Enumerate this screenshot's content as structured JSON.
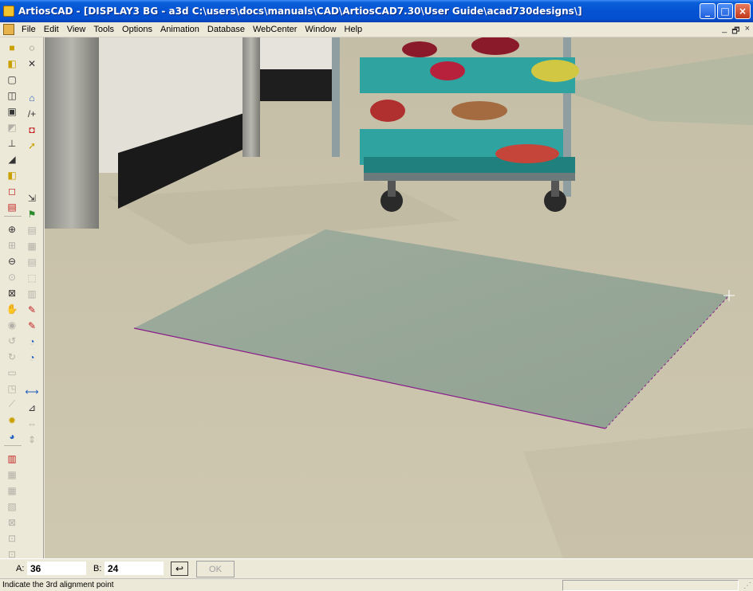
{
  "window": {
    "title": "ArtiosCAD - [DISPLAY3 BG - a3d C:\\users\\docs\\manuals\\CAD\\ArtiosCAD7.30\\User Guide\\acad730designs\\]",
    "caption_buttons": {
      "minimize": "_",
      "maximize": "□",
      "close": "×"
    }
  },
  "menubar": {
    "items": [
      {
        "label": "File"
      },
      {
        "label": "Edit"
      },
      {
        "label": "View"
      },
      {
        "label": "Tools"
      },
      {
        "label": "Options"
      },
      {
        "label": "Animation"
      },
      {
        "label": "Database"
      },
      {
        "label": "WebCenter"
      },
      {
        "label": "Window"
      },
      {
        "label": "Help"
      }
    ],
    "mdi_minimize": "_",
    "mdi_restore": "🗗",
    "mdi_close": "×"
  },
  "toolbar": {
    "col1": [
      {
        "icon": "yellow-box-icon",
        "glyph": "■",
        "tone": "yellow"
      },
      {
        "icon": "box-solid-icon",
        "glyph": "◧",
        "tone": "yellow"
      },
      {
        "icon": "box-outline-icon",
        "glyph": "▢",
        "tone": "normal"
      },
      {
        "icon": "box-3d-icon",
        "glyph": "◫",
        "tone": "normal"
      },
      {
        "icon": "box-front-icon",
        "glyph": "▣",
        "tone": "normal"
      },
      {
        "icon": "fold-icon",
        "glyph": "◩",
        "tone": "dim"
      },
      {
        "icon": "pin-icon",
        "glyph": "⊥",
        "tone": "normal"
      },
      {
        "icon": "paint-icon",
        "glyph": "◢",
        "tone": "normal"
      },
      {
        "icon": "green-box-icon",
        "glyph": "◧",
        "tone": "yellow"
      },
      {
        "icon": "red-box-icon",
        "glyph": "◻",
        "tone": "red"
      },
      {
        "icon": "pallet-icon",
        "glyph": "▤",
        "tone": "red"
      },
      {
        "sep": true
      },
      {
        "icon": "zoom-in-icon",
        "glyph": "⊕",
        "tone": "normal"
      },
      {
        "icon": "zoom-window-icon",
        "glyph": "⊞",
        "tone": "dim"
      },
      {
        "icon": "zoom-out-icon",
        "glyph": "⊖",
        "tone": "normal"
      },
      {
        "icon": "zoom-prev-icon",
        "glyph": "⊙",
        "tone": "dim"
      },
      {
        "icon": "zoom-fit-icon",
        "glyph": "⊠",
        "tone": "normal"
      },
      {
        "icon": "pan-icon",
        "glyph": "✋",
        "tone": "dim"
      },
      {
        "icon": "eye-icon",
        "glyph": "◉",
        "tone": "dim"
      },
      {
        "icon": "rotate-icon",
        "glyph": "↺",
        "tone": "dim"
      },
      {
        "icon": "orbit-icon",
        "glyph": "↻",
        "tone": "dim"
      },
      {
        "icon": "view-cube-icon",
        "glyph": "▭",
        "tone": "dim"
      },
      {
        "icon": "frame-icon",
        "glyph": "◳",
        "tone": "dim"
      },
      {
        "icon": "brush-icon",
        "glyph": "⟋",
        "tone": "dim"
      },
      {
        "icon": "light-icon",
        "glyph": "✹",
        "tone": "yellow"
      },
      {
        "icon": "camera-eye-icon",
        "glyph": "◕",
        "tone": "blue"
      },
      {
        "sep": true
      },
      {
        "icon": "red-cut-icon",
        "glyph": "▥",
        "tone": "red"
      },
      {
        "icon": "stack-icon",
        "glyph": "▦",
        "tone": "dim"
      },
      {
        "icon": "stack2-icon",
        "glyph": "▦",
        "tone": "dim"
      },
      {
        "icon": "layers-icon",
        "glyph": "▧",
        "tone": "dim"
      },
      {
        "icon": "cross-box-icon",
        "glyph": "⊠",
        "tone": "dim"
      },
      {
        "icon": "export-icon",
        "glyph": "⊡",
        "tone": "dim"
      },
      {
        "icon": "import-icon",
        "glyph": "⊡",
        "tone": "dim"
      }
    ],
    "col2": [
      {
        "icon": "sheet-rotate-icon",
        "glyph": "◌",
        "tone": "normal"
      },
      {
        "icon": "cross-arrows-icon",
        "glyph": "✕",
        "tone": "normal"
      },
      {
        "gap": true
      },
      {
        "icon": "house-icon",
        "glyph": "⌂",
        "tone": "blue"
      },
      {
        "icon": "line-add-icon",
        "glyph": "/+",
        "tone": "normal"
      },
      {
        "icon": "tray-icon",
        "glyph": "◘",
        "tone": "red"
      },
      {
        "icon": "yellow-arrow-icon",
        "glyph": "➚",
        "tone": "yellow"
      },
      {
        "gap": true
      },
      {
        "gap": true
      },
      {
        "icon": "align-icon",
        "glyph": "⇲",
        "tone": "normal"
      },
      {
        "icon": "flag-icon",
        "glyph": "⚑",
        "tone": "green"
      },
      {
        "icon": "db-icon",
        "glyph": "▤",
        "tone": "dim"
      },
      {
        "icon": "grid-icon",
        "glyph": "▦",
        "tone": "dim"
      },
      {
        "icon": "table-icon",
        "glyph": "▤",
        "tone": "dim"
      },
      {
        "icon": "select-icon",
        "glyph": "⬚",
        "tone": "dim"
      },
      {
        "icon": "stamp-icon",
        "glyph": "▥",
        "tone": "dim"
      },
      {
        "icon": "pencil-icon",
        "glyph": "✎",
        "tone": "red"
      },
      {
        "icon": "pencil2-icon",
        "glyph": "✎",
        "tone": "red"
      },
      {
        "icon": "rotate-blue-icon",
        "glyph": "◔",
        "tone": "blue"
      },
      {
        "icon": "rotate-orange-icon",
        "glyph": "◔",
        "tone": "blue"
      },
      {
        "gap": true
      },
      {
        "icon": "dimension-icon",
        "glyph": "⟷",
        "tone": "blue"
      },
      {
        "icon": "dim-angle-icon",
        "glyph": "⊿",
        "tone": "normal"
      },
      {
        "icon": "dim-2-icon",
        "glyph": "⇔",
        "tone": "dim"
      },
      {
        "icon": "dim-3-icon",
        "glyph": "⇕",
        "tone": "dim"
      }
    ]
  },
  "scene": {
    "floor_color": "#c9c2ab",
    "plane_color": "#97a798",
    "edge_color": "#8a1e8a",
    "cursor_color": "#ffffff"
  },
  "inputbar": {
    "a_label": "A:",
    "a_value": "36",
    "b_label": "B:",
    "b_value": "24",
    "undo_glyph": "↩",
    "ok_label": "OK"
  },
  "status": {
    "text": "Indicate the 3rd alignment point"
  }
}
